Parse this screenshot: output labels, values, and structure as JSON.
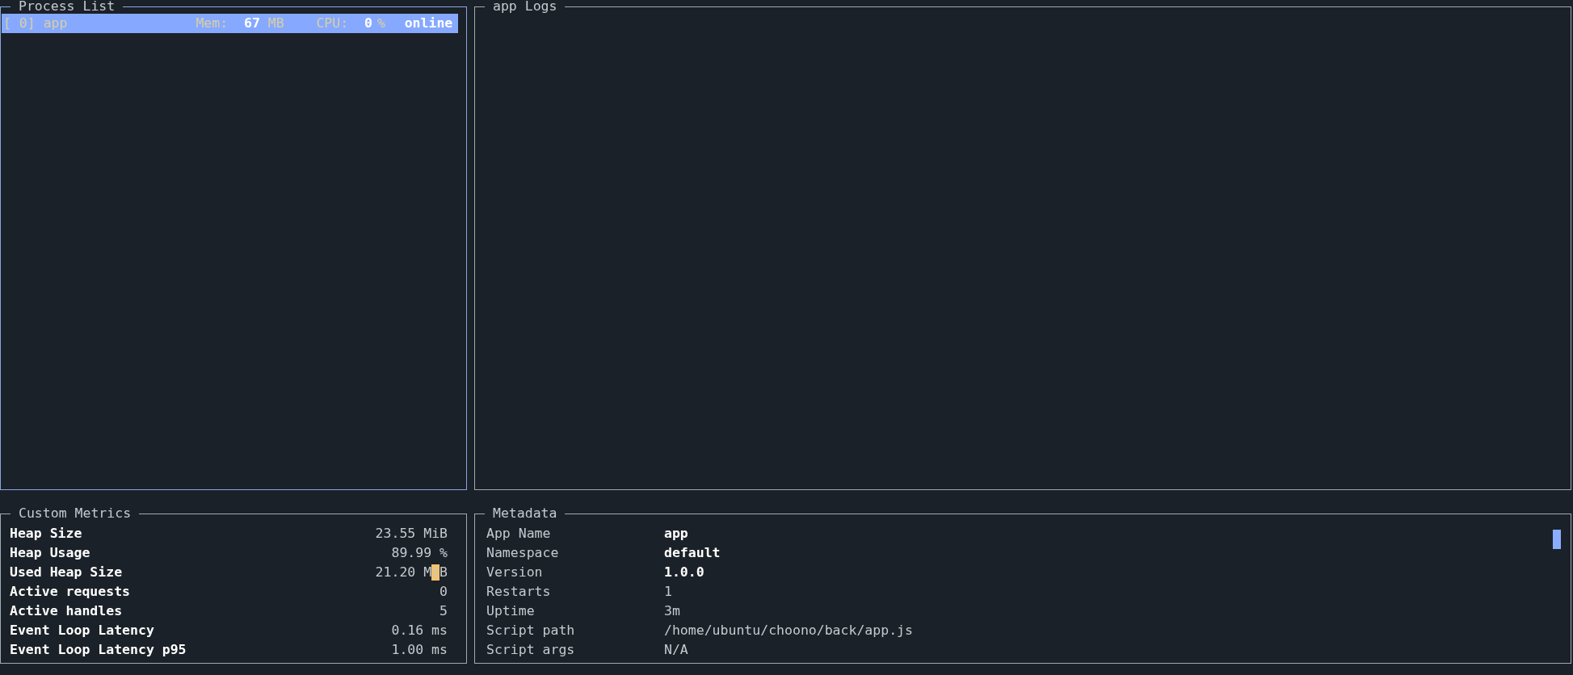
{
  "process_list": {
    "title": "Process List",
    "focused": true,
    "processes": [
      {
        "id": "[ 0]",
        "name": "app",
        "mem_label": "Mem:",
        "mem": "67",
        "mem_unit": "MB",
        "cpu_label": "CPU:",
        "cpu": "0",
        "cpu_unit": "%",
        "status": "online",
        "selected": true
      }
    ]
  },
  "logs": {
    "title": "app Logs",
    "focused": false
  },
  "custom_metrics": {
    "title": "Custom Metrics",
    "focused": false,
    "metrics": [
      {
        "name": "Heap Size",
        "value": "23.55 MiB"
      },
      {
        "name": "Heap Usage",
        "value": "89.99 %"
      },
      {
        "name": "Used Heap Size",
        "value": "21.20 MiB",
        "cursor": true
      },
      {
        "name": "Active requests",
        "value": "0"
      },
      {
        "name": "Active handles",
        "value": "5"
      },
      {
        "name": "Event Loop Latency",
        "value": "0.16 ms"
      },
      {
        "name": "Event Loop Latency p95",
        "value": "1.00 ms"
      }
    ]
  },
  "metadata": {
    "title": "Metadata",
    "focused": false,
    "rows": [
      {
        "label": "App Name",
        "value": "app",
        "bold": true
      },
      {
        "label": "Namespace",
        "value": "default",
        "bold": true
      },
      {
        "label": "Version",
        "value": "1.0.0",
        "bold": true
      },
      {
        "label": "Restarts",
        "value": "1",
        "bold": false
      },
      {
        "label": "Uptime",
        "value": "3m",
        "bold": false
      },
      {
        "label": "Script path",
        "value": "/home/ubuntu/choono/back/app.js",
        "bold": false
      },
      {
        "label": "Script args",
        "value": "N/A",
        "bold": false
      }
    ]
  }
}
